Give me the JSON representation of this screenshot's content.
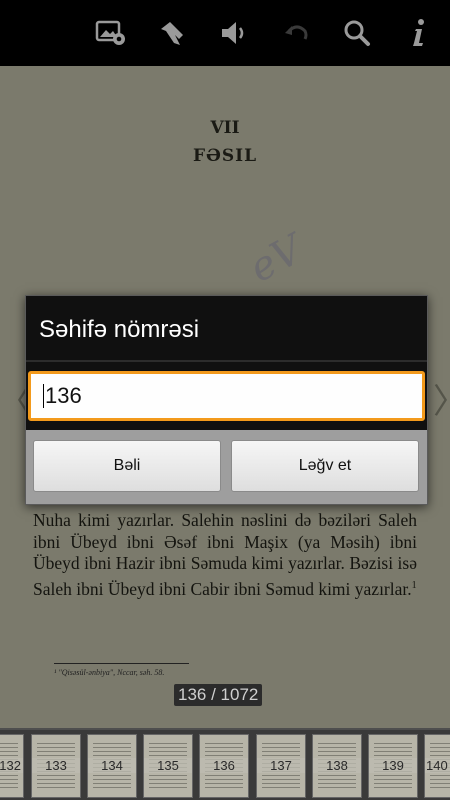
{
  "toolbar": {
    "icons": [
      "image-settings-icon",
      "bookmark-icon",
      "volume-icon",
      "undo-icon",
      "search-icon",
      "info-icon"
    ]
  },
  "page": {
    "chapter_number": "VII",
    "chapter_title": "FƏSIL",
    "watermark": "eV",
    "body_text": "Nuha kimi yazırlar. Salehin nəslini də bəziləri Saleh ibni Übeyd ibni Əsəf ibni Maşix (ya Məsih) ibni Übeyd ibni Hazir ibni Səmuda kimi yazırlar. Bəzisi isə Saleh ibni Übeyd ibni Cabir ibni Səmud kimi yazırlar.",
    "footnote_mark": "1",
    "footnote": "¹ \"Qisəsül-ənbiya\", Nccar, səh. 58.",
    "page_counter": "136 / 1072"
  },
  "dialog": {
    "title": "Səhifə nömrəsi",
    "input_value": "136",
    "yes_label": "Bəli",
    "cancel_label": "Ləğv et"
  },
  "thumbnails": [
    "132",
    "133",
    "134",
    "135",
    "136",
    "137",
    "138",
    "139",
    "140"
  ]
}
